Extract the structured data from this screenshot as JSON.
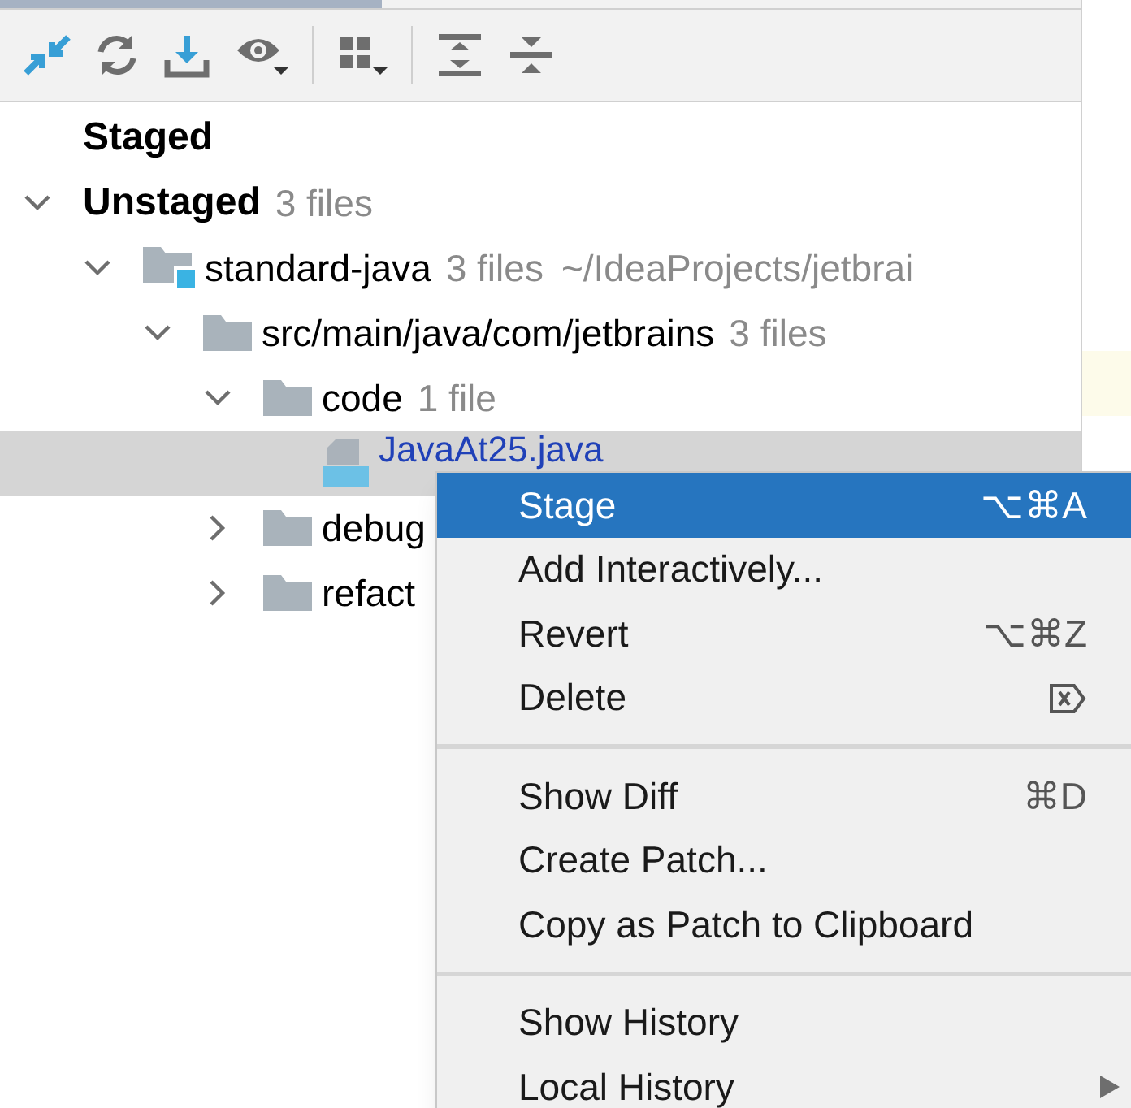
{
  "toolbar": {
    "buttons": [
      {
        "kind": "action",
        "dropdown": false
      },
      {
        "kind": "action",
        "dropdown": false
      },
      {
        "kind": "action",
        "dropdown": false
      },
      {
        "kind": "action",
        "dropdown": true
      },
      {
        "kind": "separator"
      },
      {
        "kind": "action",
        "dropdown": true
      },
      {
        "kind": "separator"
      },
      {
        "kind": "action",
        "dropdown": false
      },
      {
        "kind": "action",
        "dropdown": false
      }
    ]
  },
  "tree": [
    {
      "label": "Staged",
      "kind": "group"
    },
    {
      "label": "Unstaged",
      "kind": "group",
      "count": "3 files",
      "expanded": true,
      "children": [
        {
          "label": "standard-java",
          "kind": "module",
          "count": "3 files",
          "path": "~/IdeaProjects/jetbrai",
          "expanded": true,
          "children": [
            {
              "label": "src/main/java/com/jetbrains",
              "kind": "folder",
              "count": "3 files",
              "expanded": true,
              "children": [
                {
                  "label": "code",
                  "kind": "folder",
                  "count": "1 file",
                  "expanded": true,
                  "children": [
                    {
                      "label": "JavaAt25.java",
                      "kind": "file",
                      "selected": true
                    }
                  ]
                },
                {
                  "label": "debug",
                  "kind": "folder",
                  "expanded": false
                },
                {
                  "label": "refact",
                  "kind": "folder",
                  "expanded": false
                }
              ]
            }
          ]
        }
      ]
    }
  ],
  "context_menu": [
    {
      "kind": "item",
      "label": "Stage",
      "shortcut": "⌥⌘A",
      "selected": true
    },
    {
      "kind": "item",
      "label": "Add Interactively...",
      "selected": false
    },
    {
      "kind": "item",
      "label": "Revert",
      "shortcut": "⌥⌘Z",
      "selected": false
    },
    {
      "kind": "item",
      "label": "Delete",
      "delete_key_icon": true,
      "selected": false
    },
    {
      "kind": "separator"
    },
    {
      "kind": "item",
      "label": "Show Diff",
      "shortcut": "⌘D",
      "selected": false
    },
    {
      "kind": "item",
      "label": "Create Patch...",
      "selected": false
    },
    {
      "kind": "item",
      "label": "Copy as Patch to Clipboard",
      "selected": false
    },
    {
      "kind": "separator"
    },
    {
      "kind": "item",
      "label": "Show History",
      "selected": false
    },
    {
      "kind": "item",
      "label": "Local History",
      "submenu": true,
      "selected": false
    }
  ]
}
